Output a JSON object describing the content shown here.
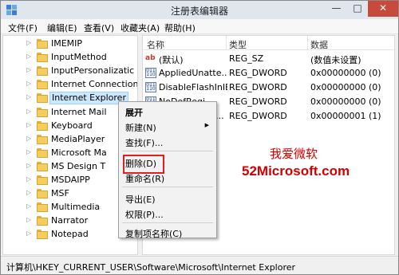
{
  "window": {
    "title": "注册表编辑器",
    "minimize_glyph": "—",
    "maximize_glyph": "□",
    "close_glyph": "✕"
  },
  "menu": [
    "文件(F)",
    "编辑(E)",
    "查看(V)",
    "收藏夹(A)",
    "帮助(H)"
  ],
  "tree": {
    "expander_glyph": "▷",
    "items": [
      {
        "label": "IMEMIP"
      },
      {
        "label": "InputMethod"
      },
      {
        "label": "InputPersonalizatic"
      },
      {
        "label": "Internet Connection"
      },
      {
        "label": "Internet Explorer",
        "selected": true
      },
      {
        "label": "Internet Mail"
      },
      {
        "label": "Keyboard"
      },
      {
        "label": "MediaPlayer"
      },
      {
        "label": "Microsoft Ma"
      },
      {
        "label": "MS Design T"
      },
      {
        "label": "MSDAIPP"
      },
      {
        "label": "MSF"
      },
      {
        "label": "Multimedia"
      },
      {
        "label": "Narrator"
      },
      {
        "label": "Notepad"
      }
    ]
  },
  "list": {
    "columns": {
      "name": "名称",
      "type": "类型",
      "data": "数据"
    },
    "rows": [
      {
        "icon": "string-value-icon",
        "name": "(默认)",
        "type": "REG_SZ",
        "data": "(数值未设置)"
      },
      {
        "icon": "binary-value-icon",
        "name": "AppliedUnatte...",
        "type": "REG_DWORD",
        "data": "0x00000000 (0)"
      },
      {
        "icon": "binary-value-icon",
        "name": "DisableFlashInIE",
        "type": "REG_DWORD",
        "data": "0x00000000 (0)"
      },
      {
        "icon": "binary-value-icon",
        "name": "NoDefRegi...",
        "type": "REG_DWORD",
        "data": "0x00000000 (0)"
      },
      {
        "icon": "binary-value-icon",
        "name": "SmartScreen...",
        "type": "REG_DWORD",
        "data": "0x00000001 (1)"
      }
    ]
  },
  "context_menu": {
    "items": [
      {
        "label": "展开",
        "bold": true
      },
      {
        "label": "新建(N)",
        "submenu": true,
        "arrow": "▶"
      },
      {
        "label": "查找(F)..."
      },
      {
        "label": "删除(D)",
        "highlighted": true
      },
      {
        "label": "重命名(R)"
      },
      {
        "label": "导出(E)"
      },
      {
        "label": "权限(P)..."
      },
      {
        "label": "复制项名称(C)"
      }
    ]
  },
  "watermark": {
    "line1": "我爱微软",
    "line2": "52Microsoft.com",
    "color": "#d40000"
  },
  "status": {
    "path": "计算机\\HKEY_CURRENT_USER\\Software\\Microsoft\\Internet Explorer"
  },
  "colors": {
    "selection": "#cce8ff",
    "close_button": "#c74a3d",
    "highlight_border": "#e02020"
  }
}
